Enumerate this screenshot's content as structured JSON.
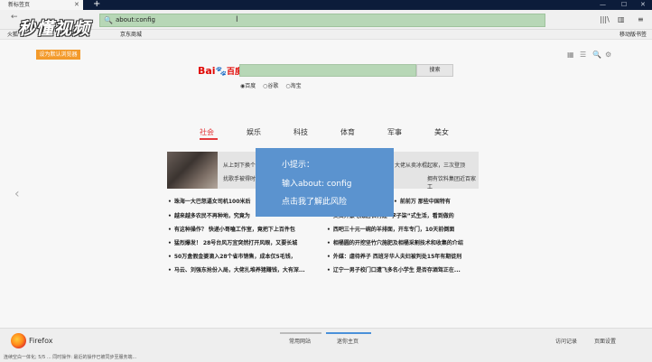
{
  "window": {
    "tab_title": "新标签页",
    "tab_close": "✕",
    "new_tab": "+",
    "minimize": "—",
    "maximize": "☐",
    "close": "✕"
  },
  "toolbar": {
    "back": "←",
    "url": "about:config",
    "url_icon": "🔍",
    "cursor": "I",
    "library_icon": "|||\\",
    "sidebar_icon": "▥",
    "menu_icon": "≡"
  },
  "bookmarks": {
    "items": [
      "火狐",
      "京东商城"
    ],
    "mobile": "移动版书签"
  },
  "watermark": "秒懂视频",
  "page": {
    "set_default": "设为默认浏览器",
    "tools": [
      "▦",
      "☰",
      "🔍",
      "⚙"
    ],
    "baidu": {
      "bai": "Bai",
      "paw": "🐾",
      "du": "百度",
      "search_button": "搜索",
      "radios": [
        "◉百度",
        "○谷歌",
        "○淘宝"
      ]
    },
    "categories": [
      "社会",
      "娱乐",
      "科技",
      "体育",
      "军事",
      "美女"
    ],
    "card": {
      "line1_left": "从上到下换个",
      "line2_left": "扰歌手被得时",
      "line1_right": "大佬从卖冰棍起家，三次登顶",
      "line2_right": "拥有饮料集团近百家工"
    },
    "news_left": [
      "珠海一大巴怒逼女司机100米后",
      "越来越多农民不再种地，究竟为",
      "有这种操作？ 快递小哥嗑工作室，竟把下上百件包",
      "猛烈爆发！ 28号台风万宜突然打开风眼，又要长城",
      "50万盒假金婆滴入28个省市销售，成本仅5毛钱，",
      "马云、刘强东抢份入局，大佬扎堆养猪赚钱，大有深..."
    ],
    "news_right": [
      "前前万 那些中国特有",
      "美女弃豪宅隐居农村过“李子柒”式生活，看到做的",
      "西吧三十元一碗的羊排面，开车专门，10天前倒面",
      "相桶圆的开挖坚竹穴施肥及相桶采割技术和收集的介绍",
      "外媒：虐待养子 西班牙华人夫妇被判处15年有期徒刑",
      "辽宁一男子校门口遭飞多名小学生 是否存酒驾正在..."
    ]
  },
  "tooltip": {
    "line1": "小提示：",
    "line2": "输入about: config",
    "line3": "点击我了解此风险"
  },
  "bottom": {
    "firefox": "Firefox",
    "tab_common": "常用网站",
    "tab_home": "迷你主页",
    "history": "访问记录",
    "page_settings": "页面设置"
  },
  "status_text": "连续空白一体化; 5/5 ... 同时操作: 最近的操作已被同步至服务端..."
}
